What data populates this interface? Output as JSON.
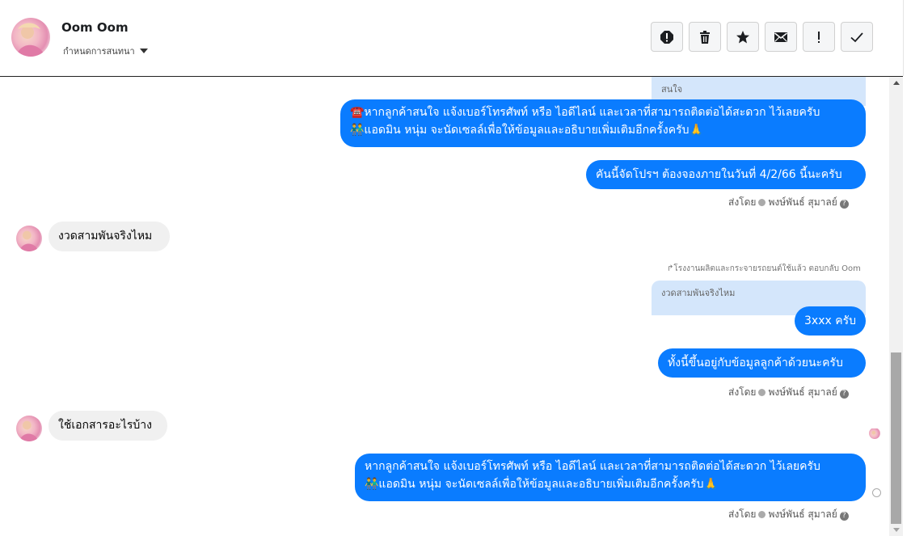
{
  "header": {
    "contact_name": "Oom Oom",
    "assign_label": "กำหนดการสนทนา",
    "actions": [
      {
        "name": "report-icon"
      },
      {
        "name": "trash-icon"
      },
      {
        "name": "star-icon"
      },
      {
        "name": "mail-icon"
      },
      {
        "name": "important-icon"
      },
      {
        "name": "check-icon"
      }
    ]
  },
  "messages": {
    "quote1": "สนใจ",
    "out1_line1": "☎️หากลูกค้าสนใจ แจ้งเบอร์โทรศัพท์ หรือ ไอดีไลน์ และเวลาที่สามารถติดต่อได้สะดวก ไว้เลยครับ",
    "out1_line2": "👬แอดมิน หนุ่ม จะนัดเซลล์เพื่อให้ข้อมูลและอธิบายเพิ่มเติมอีกครั้งครับ🙏",
    "out2": "คันนี้จัดโปรฯ ต้องจองภายในวันที่ 4/2/66 นี้นะครับ",
    "meta1_sent": "ส่งโดย",
    "meta1_sender": "พงษ์พันธ์ สุมาลย์",
    "in1": "งวดสามพันจริงไหม",
    "reply_note": "↱โรงงานผลิตและกระจายรถยนต์ใช้แล้ว ตอบกลับ Oom",
    "quote2": "งวดสามพันจริงไหม",
    "out3": "3xxx ครับ",
    "out4": "ทั้งนี้ขึ้นอยู่กับข้อมูลลูกค้าด้วยนะครับ",
    "meta2_sent": "ส่งโดย",
    "meta2_sender": "พงษ์พันธ์ สุมาลย์",
    "in2": "ใช้เอกสารอะไรบ้าง",
    "out5_line1": "หากลูกค้าสนใจ แจ้งเบอร์โทรศัพท์ หรือ ไอดีไลน์ และเวลาที่สามารถติดต่อได้สะดวก ไว้เลยครับ",
    "out5_line2": "👬แอดมิน หนุ่ม จะนัดเซลล์เพื่อให้ข้อมูลและอธิบายเพิ่มเติมอีกครั้งครับ🙏",
    "meta3_sent": "ส่งโดย",
    "meta3_sender": "พงษ์พันธ์ สุมาลย์"
  },
  "colors": {
    "outgoing_bubble": "#0a7cff",
    "incoming_bubble": "#f0f0f0",
    "quote_bg": "#d4e6fb"
  }
}
